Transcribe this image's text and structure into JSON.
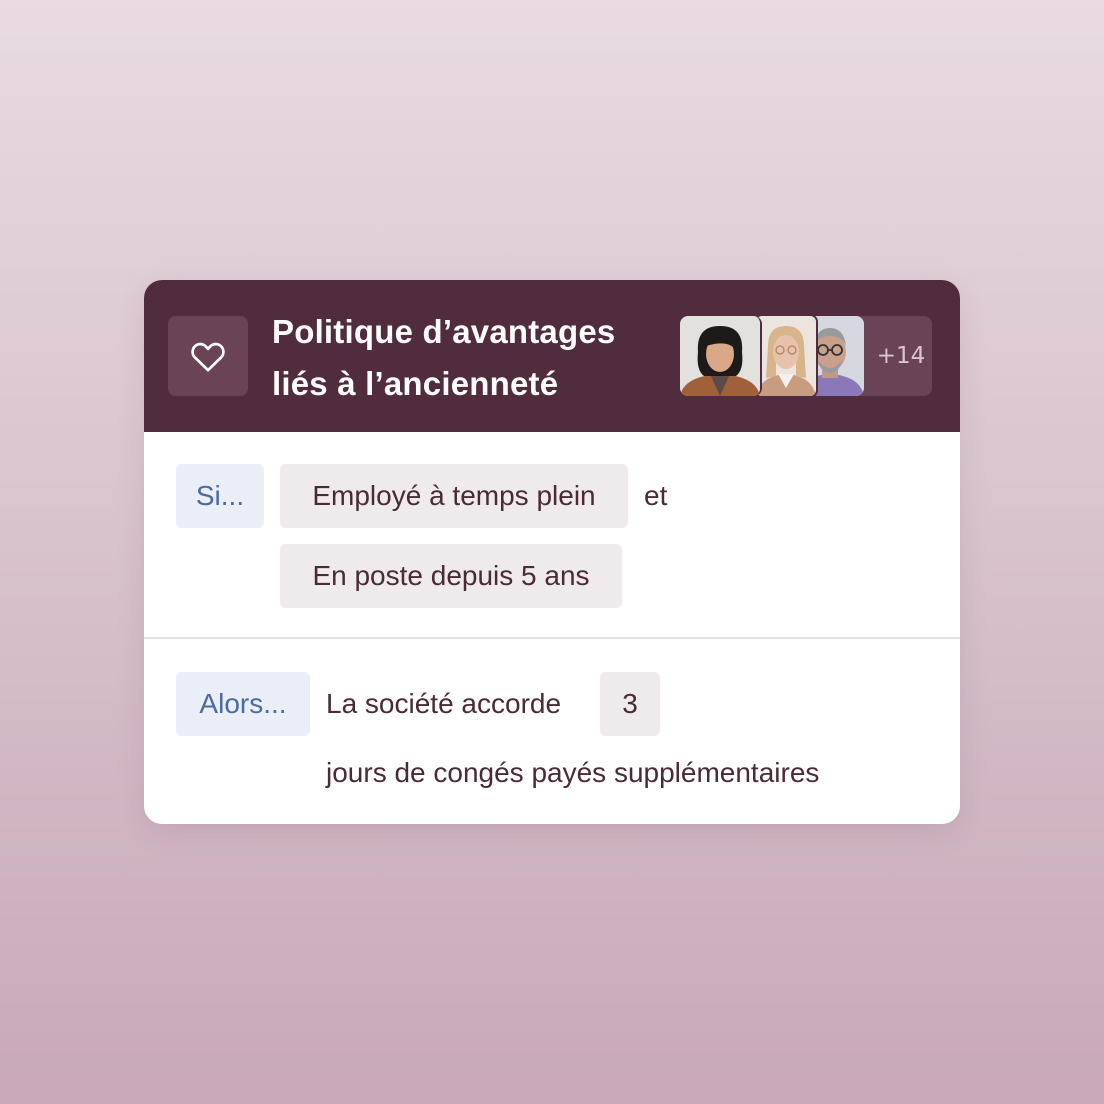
{
  "policy": {
    "title": "Politique d’avantages liés à l’ancienneté",
    "icon": "heart-icon",
    "more_count": "+14",
    "colors": {
      "header": "#512c3f",
      "tile": "#6a4357",
      "label_bg": "#e9eef7",
      "label_text": "#4a6aa3",
      "chip_bg": "#efebec",
      "text": "#4a2a38"
    }
  },
  "condition": {
    "label": "Si...",
    "chip1": "Employé à temps plein",
    "connector": "et",
    "chip2": "En poste depuis 5 ans"
  },
  "action": {
    "label": "Alors...",
    "text1": "La société accorde",
    "value": "3",
    "text2": "jours de congés payés supplémentaires"
  }
}
